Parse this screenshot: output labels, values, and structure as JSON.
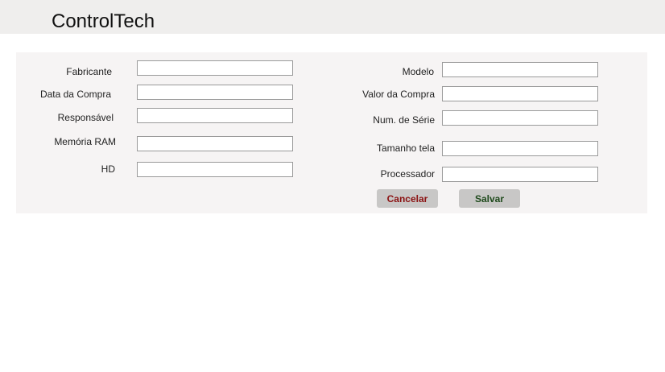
{
  "app": {
    "title": "ControlTech"
  },
  "form": {
    "left_fields": [
      {
        "label": "Fabricante",
        "value": ""
      },
      {
        "label": "Data da Compra",
        "value": ""
      },
      {
        "label": "Responsável",
        "value": ""
      },
      {
        "label": "Memória RAM",
        "value": ""
      },
      {
        "label": "HD",
        "value": ""
      }
    ],
    "right_fields": [
      {
        "label": "Modelo",
        "value": ""
      },
      {
        "label": "Valor da Compra",
        "value": ""
      },
      {
        "label": "Num. de Série",
        "value": ""
      },
      {
        "label": "Tamanho tela",
        "value": ""
      },
      {
        "label": "Processador",
        "value": ""
      }
    ]
  },
  "actions": {
    "cancel_label": "Cancelar",
    "save_label": "Salvar"
  },
  "colors": {
    "cancel_text": "#8b1212",
    "save_text": "#1f4a1c",
    "button_bg": "#c8c7c6"
  }
}
